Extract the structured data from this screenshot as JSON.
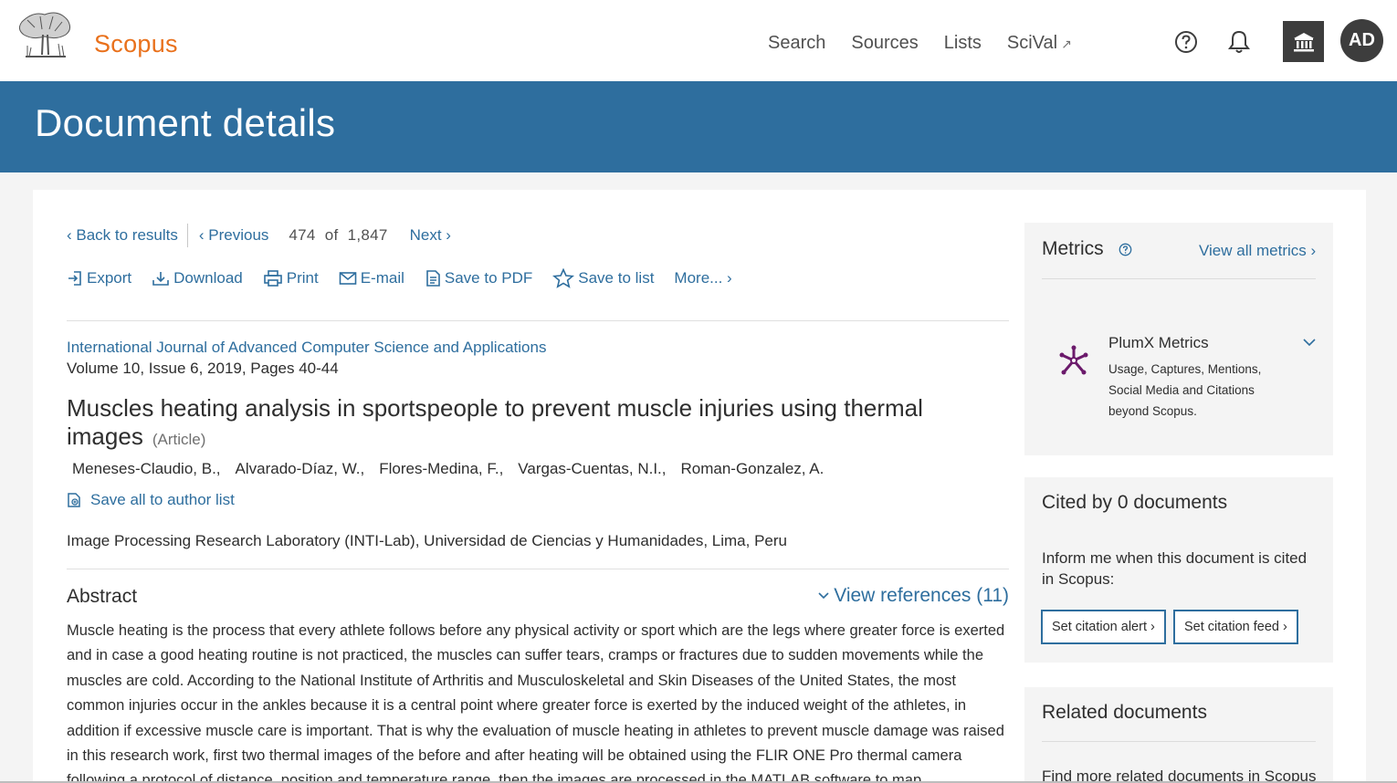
{
  "header": {
    "brand": "Scopus",
    "nav": [
      "Search",
      "Sources",
      "Lists",
      "SciVal"
    ],
    "sciVal_external_mark": "↗",
    "avatar_initials": "AD",
    "icons": [
      "elsevier-tree-logo",
      "help-icon",
      "bell-icon",
      "institution-icon"
    ]
  },
  "banner": {
    "title": "Document details"
  },
  "result_nav": {
    "back": "Back to results",
    "previous": "Previous",
    "position": "474",
    "of": "of",
    "total": "1,847",
    "next": "Next"
  },
  "toolbar": {
    "export": "Export",
    "download": "Download",
    "print": "Print",
    "email": "E-mail",
    "save_pdf": "Save to PDF",
    "save_list": "Save to list",
    "more": "More..."
  },
  "document": {
    "journal": "International Journal of Advanced Computer Science and Applications",
    "volume": "Volume 10, Issue 6, 2019, Pages 40-44",
    "title": "Muscles heating analysis in sportspeople to prevent muscle injuries using thermal images",
    "type": "(Article)",
    "authors": [
      "Meneses-Claudio, B.,",
      "Alvarado-Díaz, W.,",
      "Flores-Medina, F.,",
      "Vargas-Cuentas, N.I.,",
      "Roman-Gonzalez, A."
    ],
    "save_authors": "Save all to author list",
    "affiliation": "Image Processing Research Laboratory (INTI-Lab), Universidad de Ciencias y Humanidades, Lima, Peru"
  },
  "abstract": {
    "heading": "Abstract",
    "view_references": "View references (11)",
    "text": "Muscle heating is the process that every athlete follows before any physical activity or sport which are the legs where greater force is exerted and in case a good heating routine is not practiced, the muscles can suffer tears, cramps or fractures due to sudden movements while the muscles are cold. According to the National Institute of Arthritis and Musculoskeletal and Skin Diseases of the United States, the most common injuries occur in the ankles because it is a central point where greater force is exerted by the induced weight of the athletes, in addition if excessive muscle care is important. That is why the evaluation of muscle heating in athletes to prevent muscle damage was raised in this research work, first two thermal images of the before and after heating will be obtained using the FLIR ONE Pro thermal camera following a protocol of distance, position and temperature range, then the images are processed in the MATLAB software to map"
  },
  "sidebar": {
    "metrics": {
      "title": "Metrics",
      "view_all": "View all metrics",
      "plumx_title": "PlumX Metrics",
      "plumx_desc": "Usage, Captures, Mentions, Social Media and Citations beyond Scopus."
    },
    "cited": {
      "title": "Cited by 0 documents",
      "text": "Inform me when this document is cited in Scopus:",
      "alert_btn": "Set citation alert",
      "feed_btn": "Set citation feed"
    },
    "related": {
      "title": "Related documents",
      "text": "Find more related documents in Scopus"
    }
  },
  "colors": {
    "banner": "#2e6e9e",
    "brand": "#e9711c",
    "link": "#2e6e9e",
    "plumx": "#6b1a6b"
  }
}
